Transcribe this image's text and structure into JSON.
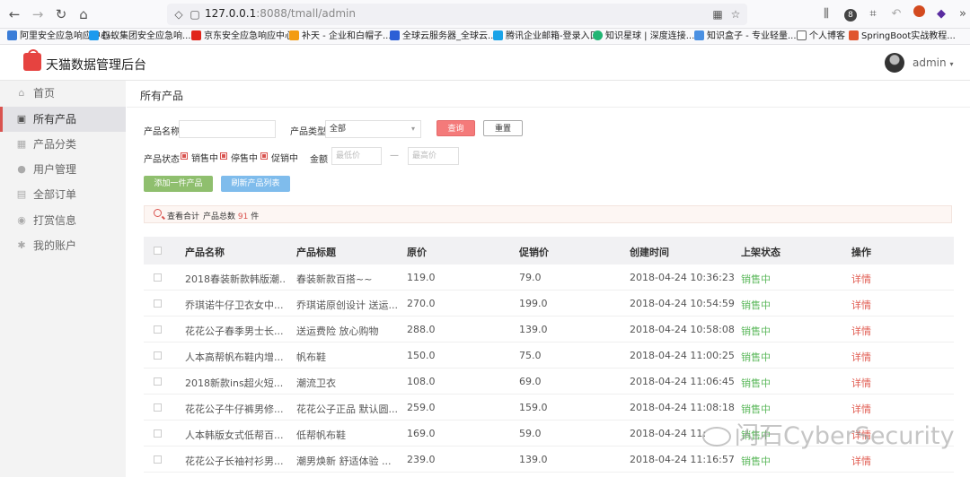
{
  "browser": {
    "url_host": "127.0.0.1",
    "url_rest": ":8088/tmall/admin",
    "badge_count": "8",
    "bookmarks": [
      {
        "label": "阿里安全应急响应中心",
        "color": "#3b7dd8"
      },
      {
        "label": "蚂蚁集团安全应急响...",
        "color": "#1b9aee"
      },
      {
        "label": "京东安全应急响应中心",
        "color": "#e1251b"
      },
      {
        "label": "补天 - 企业和白帽子...",
        "color": "#f39c12"
      },
      {
        "label": "全球云服务器_全球云...",
        "color": "#2c5fd6"
      },
      {
        "label": "腾讯企业邮箱-登录入口",
        "color": "#1aa3e8"
      },
      {
        "label": "知识星球 | 深度连接...",
        "color": "#21b573"
      },
      {
        "label": "知识盒子 - 专业轻量...",
        "color": "#4a90e2"
      },
      {
        "label": "个人博客",
        "color": "#888888"
      },
      {
        "label": "SpringBoot实战教程...",
        "color": "#e0552f"
      }
    ]
  },
  "header": {
    "title": "天猫数据管理后台",
    "user": "admin"
  },
  "sidebar": {
    "items": [
      {
        "label": "首页",
        "icon": "home-icon"
      },
      {
        "label": "所有产品",
        "icon": "product-icon"
      },
      {
        "label": "产品分类",
        "icon": "category-icon"
      },
      {
        "label": "用户管理",
        "icon": "user-icon"
      },
      {
        "label": "全部订单",
        "icon": "order-icon"
      },
      {
        "label": "打赏信息",
        "icon": "reward-icon"
      },
      {
        "label": "我的账户",
        "icon": "account-icon"
      }
    ],
    "active_index": 1
  },
  "main": {
    "page_title": "所有产品",
    "filters": {
      "name_label": "产品名称",
      "name_value": "",
      "type_label": "产品类型",
      "type_value": "全部",
      "query_btn": "查询",
      "reset_btn": "重置",
      "status_label": "产品状态",
      "status_options": [
        "销售中",
        "停售中",
        "促销中"
      ],
      "amount_label": "金额",
      "min_placeholder": "最低价",
      "dash": "—",
      "max_placeholder": "最高价"
    },
    "actions": {
      "add": "添加一件产品",
      "refresh": "刷新产品列表"
    },
    "summary": {
      "label": "查看合计",
      "count_label": "产品总数",
      "count": "91",
      "unit": "件"
    },
    "table": {
      "headers": [
        "产品名称",
        "产品标题",
        "原价",
        "促销价",
        "创建时间",
        "上架状态",
        "操作"
      ],
      "rows": [
        {
          "name": "2018春装新款韩版潮...",
          "title": "春装新款百搭~~",
          "price": "119.0",
          "sale": "79.0",
          "created": "2018-04-24 10:36:23",
          "status": "销售中",
          "op": "详情"
        },
        {
          "name": "乔琪诺牛仔卫衣女中...",
          "title": "乔琪诺原创设计 送运...",
          "price": "270.0",
          "sale": "199.0",
          "created": "2018-04-24 10:54:59",
          "status": "销售中",
          "op": "详情"
        },
        {
          "name": "花花公子春季男士长...",
          "title": "送运费险 放心购物",
          "price": "288.0",
          "sale": "139.0",
          "created": "2018-04-24 10:58:08",
          "status": "销售中",
          "op": "详情"
        },
        {
          "name": "人本高帮帆布鞋内增...",
          "title": "帆布鞋",
          "price": "150.0",
          "sale": "75.0",
          "created": "2018-04-24 11:00:25",
          "status": "销售中",
          "op": "详情"
        },
        {
          "name": "2018新款ins超火短...",
          "title": "潮流卫衣",
          "price": "108.0",
          "sale": "69.0",
          "created": "2018-04-24 11:06:45",
          "status": "销售中",
          "op": "详情"
        },
        {
          "name": "花花公子牛仔裤男修...",
          "title": "花花公子正品 默认圆...",
          "price": "259.0",
          "sale": "159.0",
          "created": "2018-04-24 11:08:18",
          "status": "销售中",
          "op": "详情"
        },
        {
          "name": "人本韩版女式低帮百...",
          "title": "低帮帆布鞋",
          "price": "169.0",
          "sale": "59.0",
          "created": "2018-04-24 11:",
          "status": "销售中",
          "op": "详情"
        },
        {
          "name": "花花公子长袖衬衫男...",
          "title": "潮男焕新 舒适体验 ...",
          "price": "239.0",
          "sale": "139.0",
          "created": "2018-04-24 11:16:57",
          "status": "销售中",
          "op": "详情"
        }
      ]
    }
  },
  "watermark": "闪石CyberSecurity",
  "colors": {
    "accent": "#d9534f",
    "status_green": "#5cb85c",
    "link_red": "#e05a4f"
  }
}
